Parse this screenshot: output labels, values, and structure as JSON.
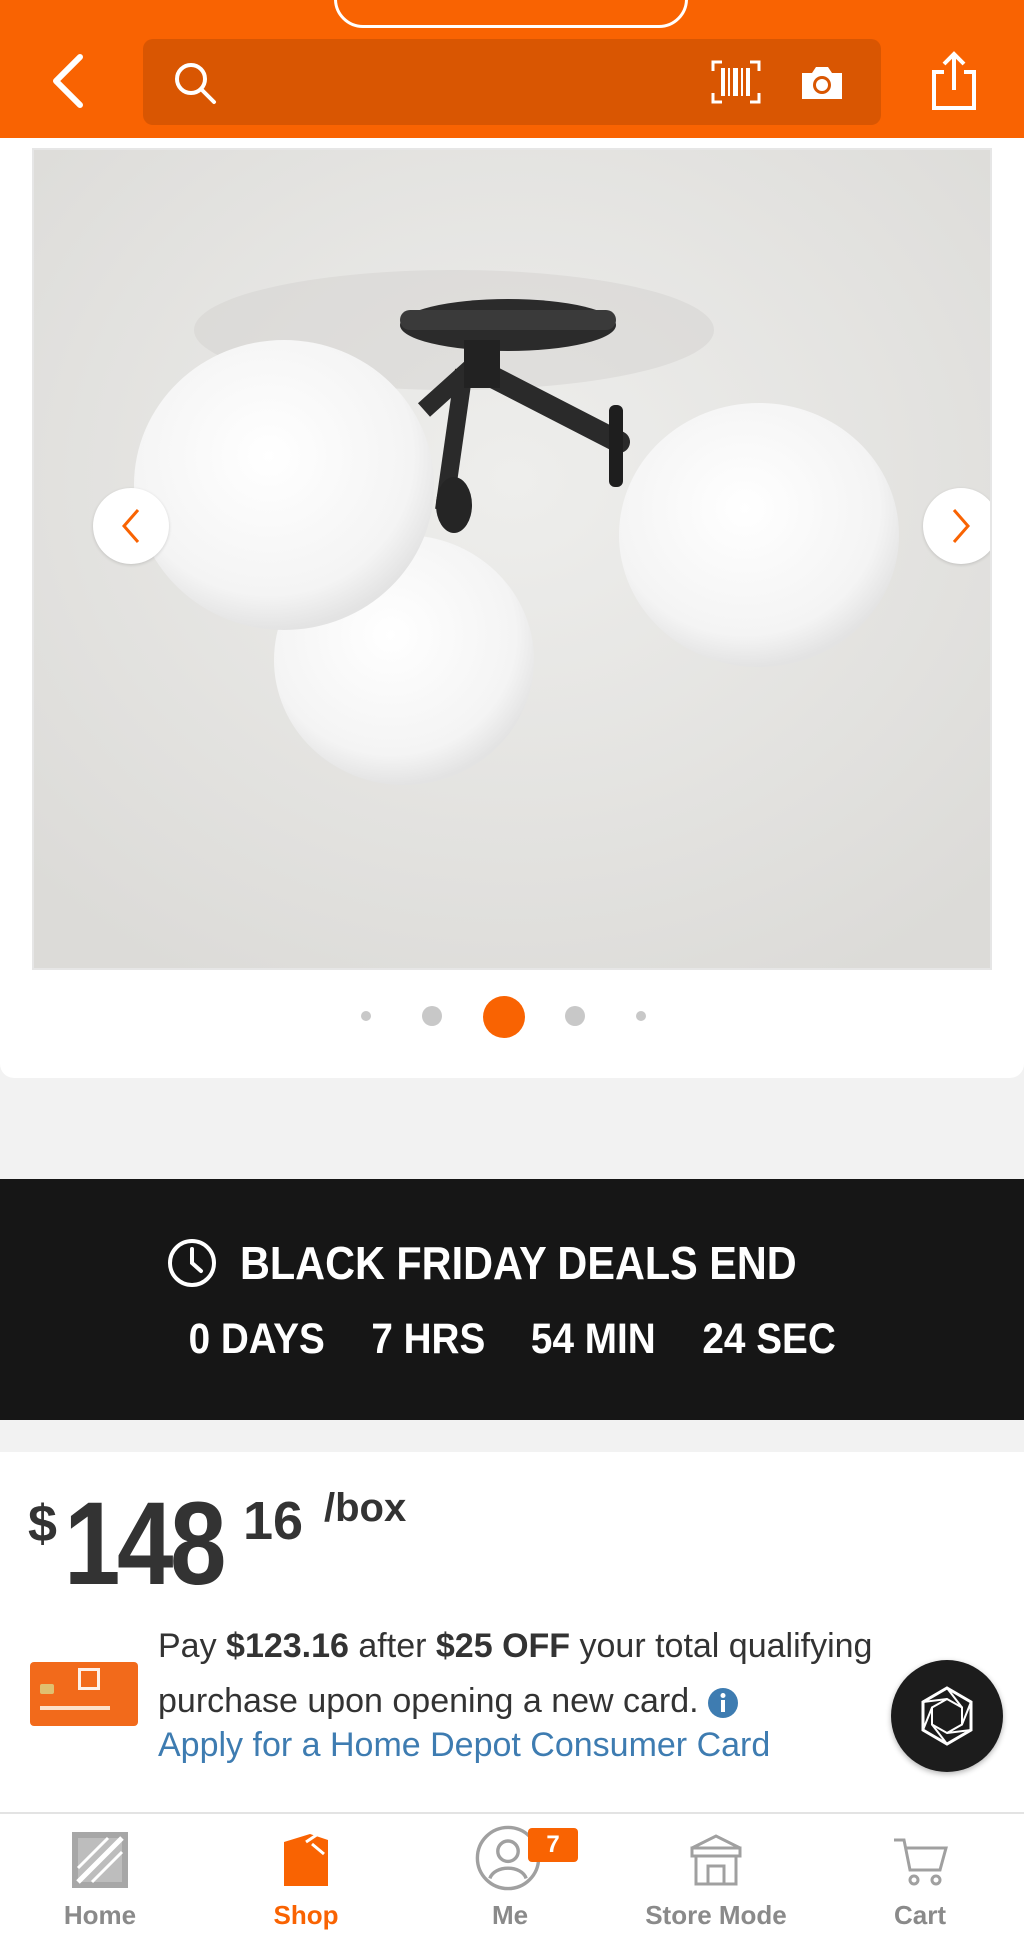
{
  "header": {
    "search_placeholder": "",
    "icons": [
      "back-icon",
      "search-icon",
      "barcode-icon",
      "camera-icon",
      "share-icon"
    ]
  },
  "gallery": {
    "image_alt": "Three-light black ceiling fixture with white globe shades",
    "dot_count": 5,
    "active_dot_index": 2
  },
  "countdown": {
    "title": "BLACK FRIDAY DEALS END",
    "days": "0 DAYS",
    "hours": "7 HRS",
    "minutes": "54 MIN",
    "seconds": "24 SEC"
  },
  "price": {
    "currency": "$",
    "dollars": "148",
    "cents": "16",
    "unit": "/box"
  },
  "promo": {
    "pay_text": "Pay ",
    "pay_amount": "$123.16",
    "after_text": " after ",
    "discount": "$25 OFF",
    "rest_text": " your total qualifying purchase upon opening a new card.",
    "apply_link": "Apply for a Home Depot Consumer Card"
  },
  "nav": {
    "items": [
      {
        "label": "Home",
        "icon": "home-depot-logo-icon"
      },
      {
        "label": "Shop",
        "icon": "shop-bag-icon"
      },
      {
        "label": "Me",
        "icon": "user-icon",
        "badge": "7"
      },
      {
        "label": "Store Mode",
        "icon": "store-icon"
      },
      {
        "label": "Cart",
        "icon": "cart-icon"
      }
    ],
    "active": "Shop"
  },
  "colors": {
    "brand_orange": "#f96302",
    "countdown_bg": "#161616",
    "link_blue": "#3e7cb1"
  }
}
